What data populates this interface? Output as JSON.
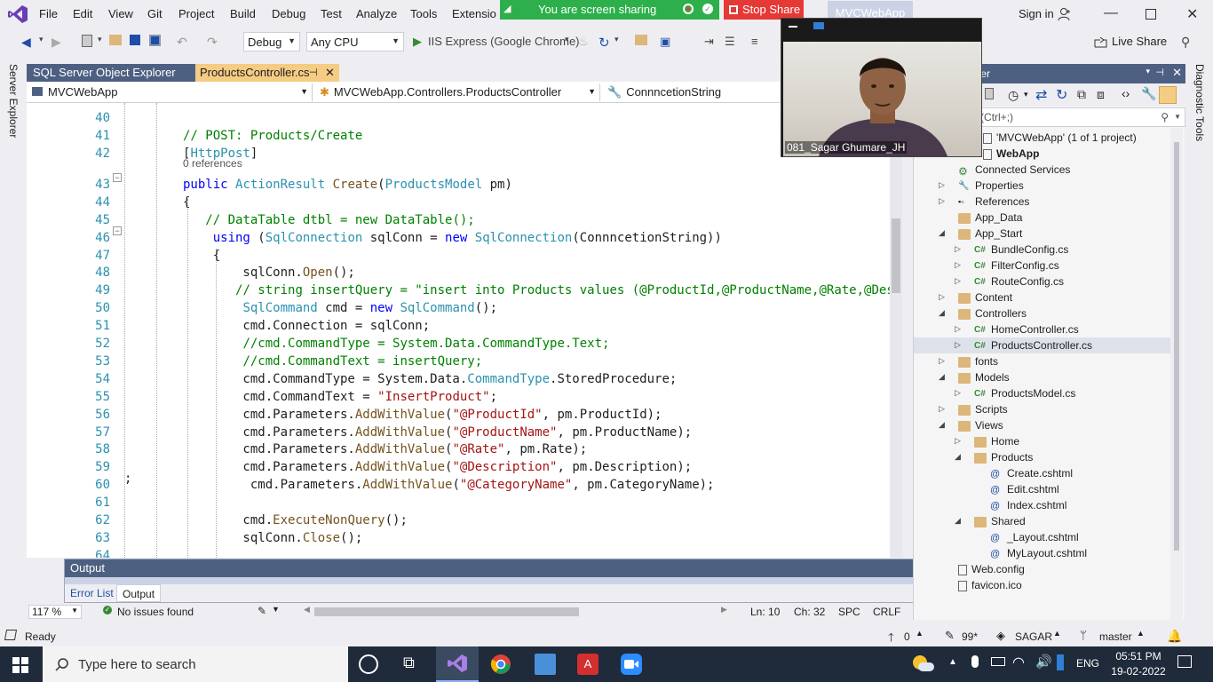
{
  "menu": {
    "items": [
      "File",
      "Edit",
      "View",
      "Git",
      "Project",
      "Build",
      "Debug",
      "Test",
      "Analyze",
      "Tools",
      "Extensio"
    ]
  },
  "share": {
    "status": "You are screen sharing",
    "stop": "Stop Share"
  },
  "title": {
    "solution": "MVCWebApp",
    "signin": "Sign in"
  },
  "toolbar": {
    "config": "Debug",
    "platform": "Any CPU",
    "run": "IIS Express (Google Chrome)",
    "liveshare": "Live Share"
  },
  "leftstrip": {
    "label": "Server Explorer"
  },
  "rightstrip": {
    "label": "Diagnostic Tools"
  },
  "tabs": {
    "tab1": "SQL Server Object Explorer",
    "tab2": "ProductsController.cs",
    "pin": "⊣",
    "close": "✕"
  },
  "nav": {
    "project": "MVCWebApp",
    "class": "MVCWebApp.Controllers.ProductsController",
    "member": "ConnncetionString"
  },
  "codelens": "0 references",
  "semicolon": ";",
  "code": {
    "numbers": [
      "40",
      "41",
      "42",
      "43",
      "44",
      "45",
      "46",
      "47",
      "48",
      "49",
      "50",
      "51",
      "52",
      "53",
      "54",
      "55",
      "56",
      "57",
      "58",
      "59",
      "60",
      "61",
      "62",
      "63",
      "64"
    ]
  },
  "editor_status": {
    "zoom": "117 %",
    "issues": "No issues found",
    "ln": "Ln: 10",
    "ch": "Ch: 32",
    "spc": "SPC",
    "crlf": "CRLF"
  },
  "output": {
    "title": "Output",
    "tabs": [
      "Error List",
      "Output"
    ]
  },
  "solution": {
    "header": "...lorer",
    "search": "...n Explorer (Ctrl+;)",
    "items": [
      {
        "label": "'MVCWebApp' (1 of 1 project)"
      },
      {
        "label": "WebApp"
      },
      {
        "label": "Connected Services"
      },
      {
        "label": "Properties"
      },
      {
        "label": "References"
      },
      {
        "label": "App_Data"
      },
      {
        "label": "App_Start"
      },
      {
        "label": "BundleConfig.cs"
      },
      {
        "label": "FilterConfig.cs"
      },
      {
        "label": "RouteConfig.cs"
      },
      {
        "label": "Content"
      },
      {
        "label": "Controllers"
      },
      {
        "label": "HomeController.cs"
      },
      {
        "label": "ProductsController.cs"
      },
      {
        "label": "fonts"
      },
      {
        "label": "Models"
      },
      {
        "label": "ProductsModel.cs"
      },
      {
        "label": "Scripts"
      },
      {
        "label": "Views"
      },
      {
        "label": "Home"
      },
      {
        "label": "Products"
      },
      {
        "label": "Create.cshtml"
      },
      {
        "label": "Edit.cshtml"
      },
      {
        "label": "Index.cshtml"
      },
      {
        "label": "Shared"
      },
      {
        "label": "_Layout.cshtml"
      },
      {
        "label": "MyLayout.cshtml"
      },
      {
        "label": "Web.config"
      },
      {
        "label": "favicon.ico"
      }
    ]
  },
  "webcam": {
    "name": "081_Sagar Ghumare_JH"
  },
  "statusbar": {
    "ready": "Ready",
    "up": "0",
    "pencil": "99*",
    "user": "SAGAR",
    "branch": "master"
  },
  "taskbar": {
    "search": "Type here to search",
    "time": "05:51 PM",
    "date": "19-02-2022",
    "lang": "ENG"
  }
}
